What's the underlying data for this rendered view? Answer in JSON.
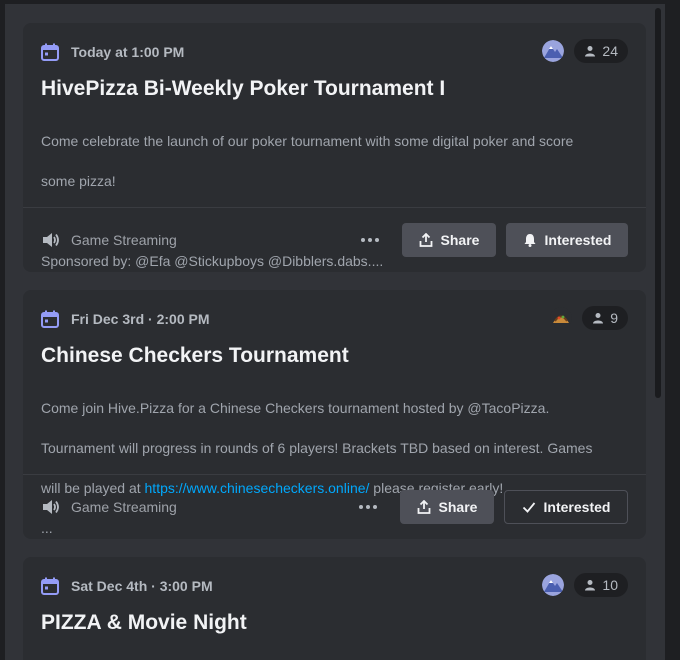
{
  "events": [
    {
      "date": "Today at 1:00 PM",
      "count": "24",
      "title": "HivePizza Bi-Weekly Poker Tournament I",
      "desc_line1": "Come celebrate the launch of our poker tournament with some digital poker and score",
      "desc_line2": "some pizza!",
      "desc_line3": "",
      "desc_line4": "Sponsored by: @Efa @Stickupboys @Dibblers.dabs....",
      "location": "Game Streaming",
      "share_label": "Share",
      "interested_label": "Interested",
      "avatar_icon": "mountain-avatar-icon"
    },
    {
      "date": "Fri Dec 3rd · 2:00 PM",
      "count": "9",
      "title": "Chinese Checkers Tournament",
      "desc_line1": "Come join Hive.Pizza for a Chinese Checkers tournament hosted by @TacoPizza.",
      "desc_line2": "Tournament will progress in rounds of 6 players! Brackets TBD based on interest. Games",
      "desc_line3_pre": "will be played at ",
      "desc_link": "https://www.chinesecheckers.online/",
      "desc_line3_post": " please register early!",
      "desc_line4": "...",
      "location": "Game Streaming",
      "share_label": "Share",
      "interested_label": "Interested",
      "avatar_icon": "taco-avatar-icon"
    },
    {
      "date": "Sat Dec 4th · 3:00 PM",
      "count": "10",
      "title": "PIZZA & Movie Night",
      "avatar_icon": "mountain-avatar-icon"
    }
  ],
  "colors": {
    "accent": "#949cf7",
    "link": "#00a8fc",
    "button": "#4e5058"
  }
}
